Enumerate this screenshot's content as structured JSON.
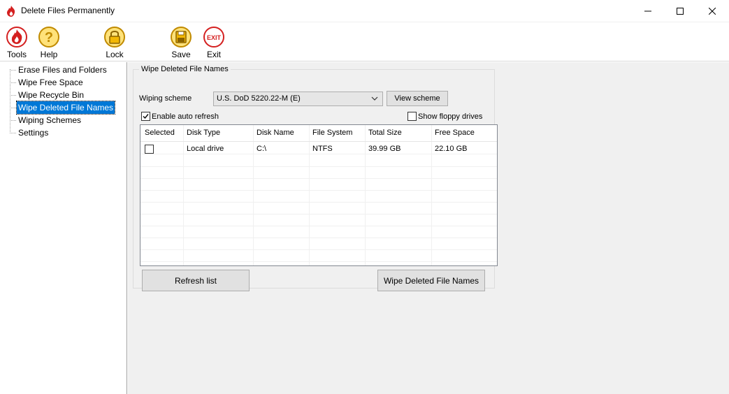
{
  "window": {
    "title": "Delete Files Permanently"
  },
  "toolbar": {
    "items": [
      {
        "label": "Tools",
        "icon": "tools-icon"
      },
      {
        "label": "Help",
        "icon": "help-icon"
      },
      {
        "label": "Lock",
        "icon": "lock-icon"
      },
      {
        "label": "Save",
        "icon": "save-icon"
      },
      {
        "label": "Exit",
        "icon": "exit-icon",
        "badge": "EXIT"
      }
    ]
  },
  "sidebar": {
    "items": [
      {
        "label": "Erase Files and Folders"
      },
      {
        "label": "Wipe Free Space"
      },
      {
        "label": "Wipe Recycle Bin"
      },
      {
        "label": "Wipe Deleted File Names",
        "selected": true
      },
      {
        "label": "Wiping Schemes"
      },
      {
        "label": "Settings"
      }
    ]
  },
  "main": {
    "group_title": "Wipe Deleted File Names",
    "wiping_scheme_label": "Wiping scheme",
    "wiping_scheme_value": "U.S. DoD 5220.22-M (E)",
    "view_scheme_button": "View scheme",
    "auto_refresh_label": "Enable auto refresh",
    "auto_refresh_checked": true,
    "floppy_label": "Show floppy drives",
    "floppy_checked": false,
    "table": {
      "columns": [
        "Selected",
        "Disk Type",
        "Disk Name",
        "File System",
        "Total Size",
        "Free Space"
      ],
      "rows": [
        {
          "selected": false,
          "disk_type": "Local drive",
          "disk_name": "C:\\",
          "file_system": "NTFS",
          "total_size": "39.99 GB",
          "free_space": "22.10 GB"
        }
      ]
    },
    "refresh_button": "Refresh list",
    "wipe_button": "Wipe Deleted File Names"
  },
  "colors": {
    "selection": "#0078d7",
    "panel": "#f0f0f0",
    "exit_red": "#d42020",
    "icon_gold": "#f2b705"
  }
}
